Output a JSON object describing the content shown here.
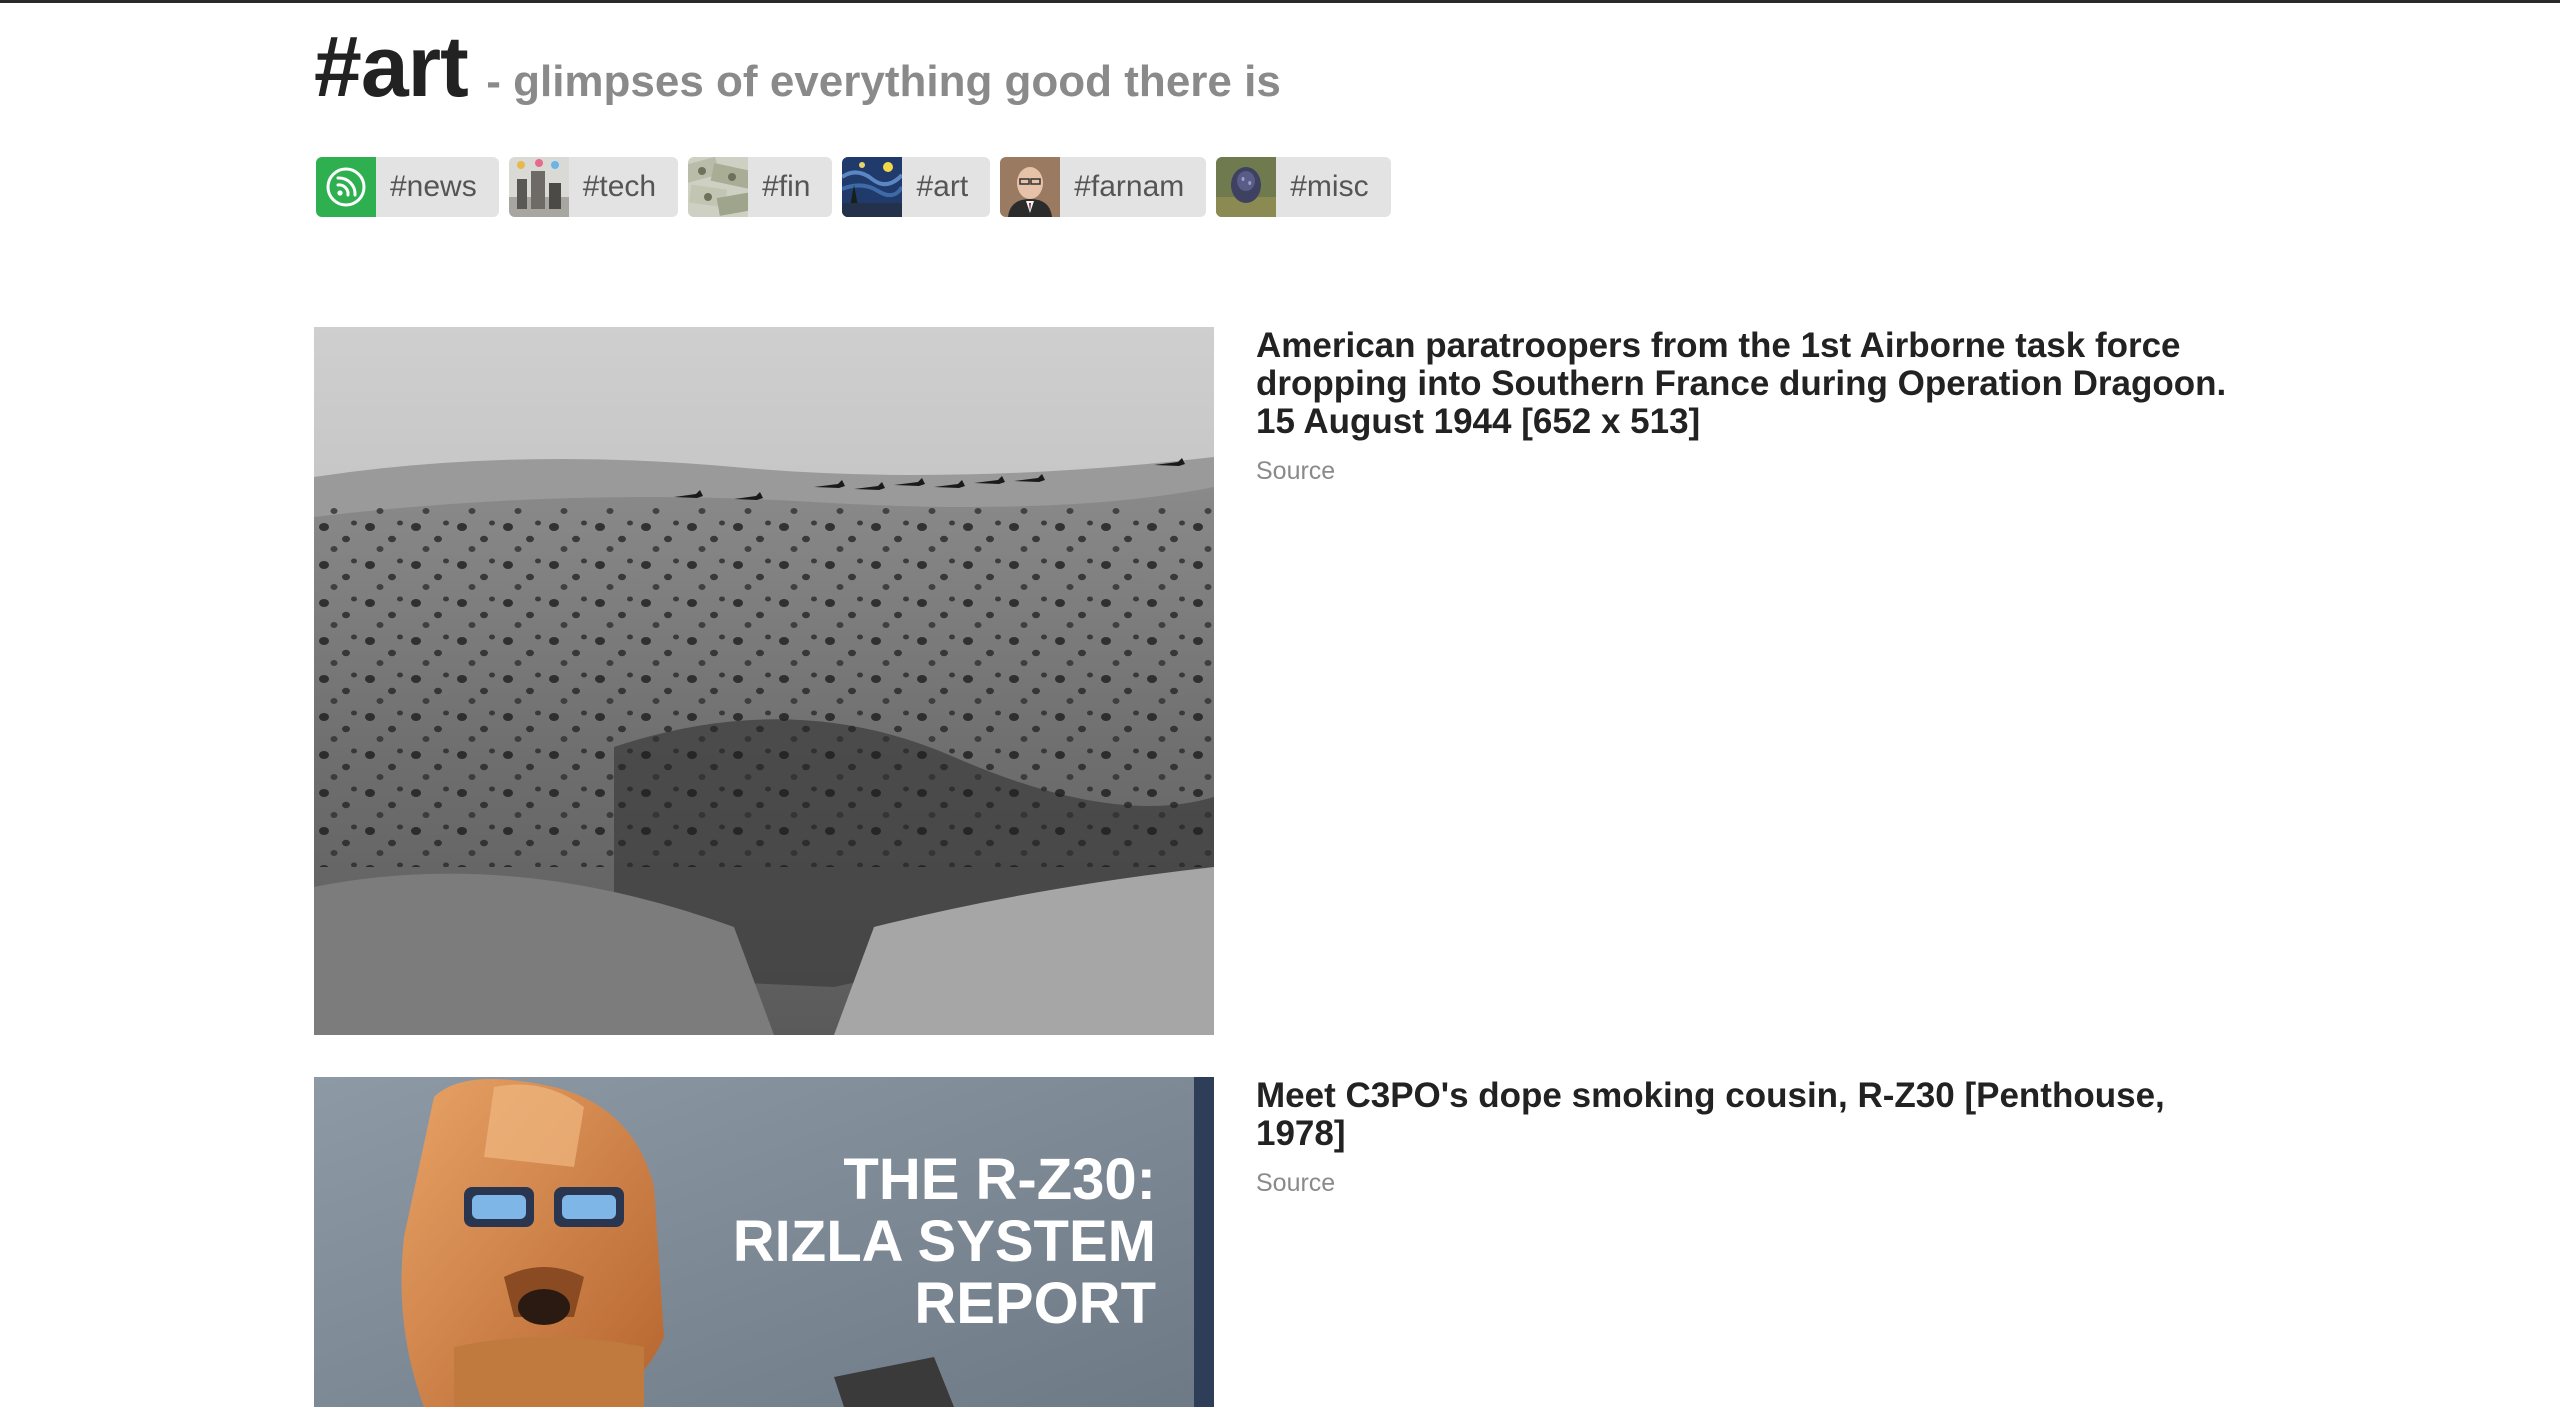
{
  "header": {
    "title": "#art",
    "tagline": "- glimpses of everything good there is"
  },
  "nav": {
    "items": [
      {
        "label": "#news",
        "icon": "rss-icon"
      },
      {
        "label": "#tech",
        "icon": "tech-thumbnail"
      },
      {
        "label": "#fin",
        "icon": "money-thumbnail"
      },
      {
        "label": "#art",
        "icon": "starry-night-thumbnail"
      },
      {
        "label": "#farnam",
        "icon": "portrait-thumbnail"
      },
      {
        "label": "#misc",
        "icon": "misc-thumbnail"
      }
    ]
  },
  "posts": [
    {
      "title": "American paratroopers from the 1st Airborne task force dropping into Southern France during Operation Dragoon. 15 August 1944 [652 x 513]",
      "source_label": "Source",
      "image": "aerial-paratroopers-photo"
    },
    {
      "title": "Meet C3PO's dope smoking cousin, R-Z30 [Penthouse, 1978]",
      "source_label": "Source",
      "image": "rz30-robot-magazine-page",
      "image_text": [
        "THE R-Z30:",
        "RIZLA SYSTEM",
        "REPORT"
      ]
    }
  ],
  "colors": {
    "nav_bg": "#e3e3e3",
    "news_green": "#2fb050",
    "tagline_gray": "#8a8a8a",
    "title_dark": "#222222"
  }
}
